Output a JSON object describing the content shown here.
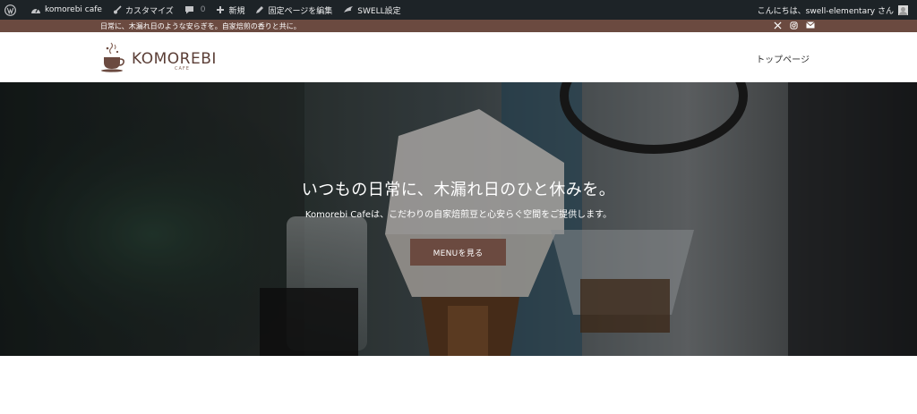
{
  "admin_bar": {
    "wp_icon": "wordpress-icon",
    "site_name": "komorebi cafe",
    "customize": "カスタマイズ",
    "comments_count": "0",
    "new": "新規",
    "edit_page": "固定ページを編集",
    "swell_settings": "SWELL設定",
    "greeting": "こんにちは、swell-elementary さん"
  },
  "info_bar": {
    "message": "日常に、木漏れ日のような安らぎを。自家焙煎の香りと共に。",
    "icons": [
      "x-icon",
      "instagram-icon",
      "mail-icon"
    ]
  },
  "header": {
    "logo_main": "KOMOREBI",
    "logo_sub": "CAFE",
    "nav_top": "トップページ"
  },
  "hero": {
    "title": "いつもの日常に、木漏れ日のひと休みを。",
    "subtitle": "Komorebi Cafeは、こだわりの自家焙煎豆と心安らぐ空間をご提供します。",
    "button": "MENUを見る"
  },
  "colors": {
    "admin_bar": "#1d2327",
    "brand_brown": "#6b4a40",
    "logo_text": "#5b3e36"
  }
}
